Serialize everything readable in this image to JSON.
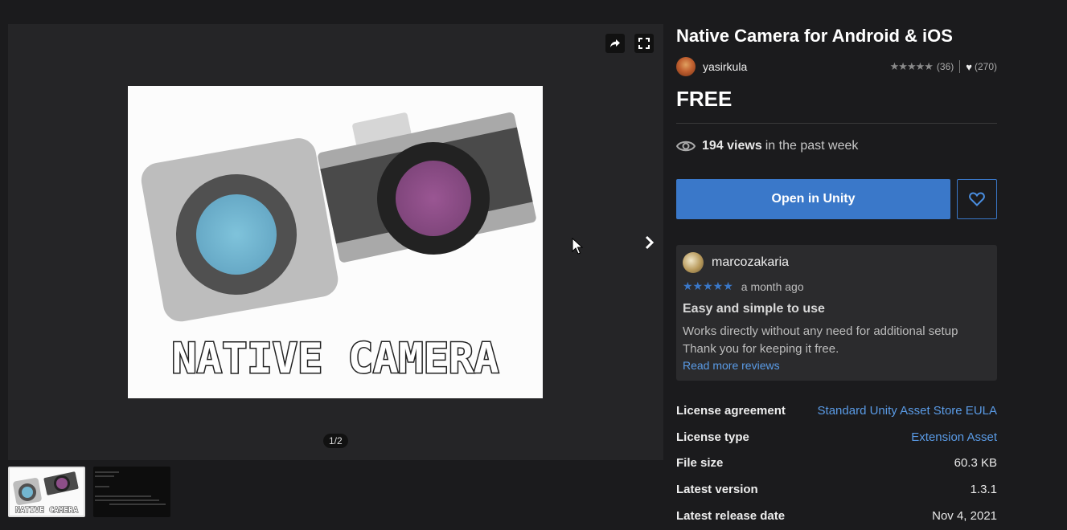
{
  "gallery": {
    "pager": "1/2",
    "hero_text": "NATIVE CAMERA",
    "thumb_text": "NATIVE CAMERA"
  },
  "product": {
    "title": "Native Camera for Android & iOS",
    "publisher": "yasirkula",
    "rating_count": "(36)",
    "favorites_count": "(270)",
    "price": "FREE",
    "views_count": "194 views",
    "views_suffix": "in the past week",
    "open_button": "Open in Unity"
  },
  "review": {
    "user": "marcozakaria",
    "stars": "★★★★★",
    "date": "a month ago",
    "title": "Easy and simple to use",
    "body_line1": "Works directly without any need for additional setup",
    "body_line2": "Thank you for keeping it free.",
    "link": "Read more reviews"
  },
  "details": [
    {
      "label": "License agreement",
      "value": "Standard Unity Asset Store EULA",
      "link": true
    },
    {
      "label": "License type",
      "value": "Extension Asset",
      "link": true
    },
    {
      "label": "File size",
      "value": "60.3 KB",
      "link": false
    },
    {
      "label": "Latest version",
      "value": "1.3.1",
      "link": false
    },
    {
      "label": "Latest release date",
      "value": "Nov 4, 2021",
      "link": false
    }
  ],
  "colors": {
    "accent": "#3a78c9",
    "link": "#5a9be6",
    "background": "#1b1b1d"
  },
  "icons": [
    "share-icon",
    "fullscreen-icon",
    "chevron-right-icon",
    "eye-icon",
    "heart-icon",
    "star-icon",
    "cursor-icon"
  ]
}
